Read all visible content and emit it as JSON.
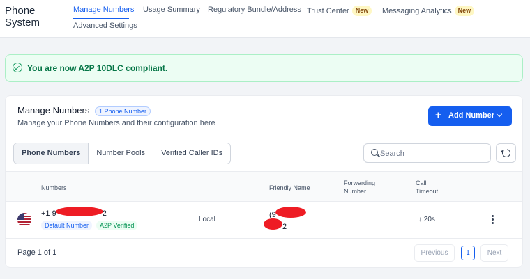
{
  "app": {
    "title": "Phone System"
  },
  "nav": {
    "tabs": [
      {
        "label": "Manage Numbers",
        "active": true
      },
      {
        "label": "Usage Summary"
      },
      {
        "label": "Regulatory Bundle/Address"
      },
      {
        "label": "Trust Center",
        "badge": "New"
      },
      {
        "label": "Messaging Analytics",
        "badge": "New"
      },
      {
        "label": "Advanced Settings"
      }
    ]
  },
  "banner": {
    "text": "You are now A2P 10DLC compliant.",
    "icon": "check-circle-icon"
  },
  "card": {
    "title": "Manage Numbers",
    "count_badge": "1 Phone Number",
    "subtitle": "Manage your Phone Numbers and their configuration here",
    "add_button": "Add Number"
  },
  "segments": [
    "Phone Numbers",
    "Number Pools",
    "Verified Caller IDs"
  ],
  "search": {
    "placeholder": "Search"
  },
  "table": {
    "headers": {
      "numbers": "Numbers",
      "friendly": "Friendly Name",
      "forwarding": "Forwarding Number",
      "timeout": "Call Timeout"
    },
    "rows": [
      {
        "number_prefix": "+1 9",
        "number_suffix": "2",
        "tag_default": "Default Number",
        "tag_verified": "A2P Verified",
        "type": "Local",
        "friendly_prefix": "(9",
        "friendly_suffix": "2",
        "timeout": "↓ 20s"
      }
    ]
  },
  "pagination": {
    "info": "Page 1 of 1",
    "previous": "Previous",
    "page": "1",
    "next": "Next"
  },
  "colors": {
    "accent": "#155eef",
    "success": "#079455",
    "redaction": "#ee1c24"
  }
}
